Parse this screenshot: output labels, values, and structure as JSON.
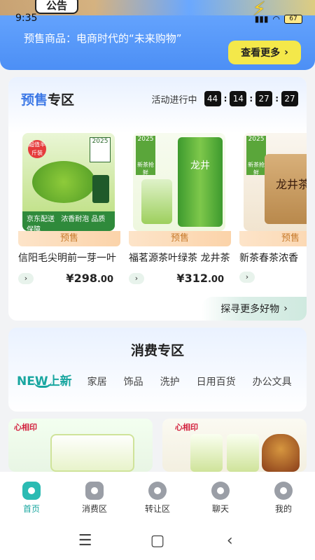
{
  "status_bar": {
    "time": "9:35",
    "battery": "67"
  },
  "notice": {
    "tag": "公告",
    "text": "预售商品：电商时代的“未来购物”",
    "more_button": "查看更多"
  },
  "presale": {
    "title_highlight": "预售",
    "title_rest": "专区",
    "countdown_label": "活动进行中",
    "countdown": [
      "44",
      "14",
      "27",
      "27"
    ],
    "pre_label": "预售",
    "products": [
      {
        "name": "信阳毛尖明前一芽一叶",
        "price_int": "298",
        "price_dec": ".00",
        "img_year": "2025",
        "img_badge": "超值半斤装",
        "tag_line1": "京东配送",
        "tag_line2": "浓香耐泡 品质保障"
      },
      {
        "name": "福茗源茶叶绿茶 龙井茶",
        "price_int": "312",
        "price_dec": ".00",
        "img_year": "2025",
        "img_badge": "新茶抢鲜",
        "can_text": "龙井"
      },
      {
        "name": "新茶春茶浓香",
        "price_int": "",
        "price_dec": "",
        "img_year": "2025",
        "img_badge": "新茶抢鲜",
        "can_text": "龙井茶"
      }
    ],
    "explore_text": "探寻更多好物"
  },
  "consume": {
    "title": "消费专区",
    "tabs": [
      {
        "label": "NEW上新",
        "active": true
      },
      {
        "label": "家居",
        "active": false
      },
      {
        "label": "饰品",
        "active": false
      },
      {
        "label": "洗护",
        "active": false
      },
      {
        "label": "日用百货",
        "active": false
      },
      {
        "label": "办公文具",
        "active": false
      }
    ],
    "cards": [
      {
        "brand": "心相印"
      },
      {
        "brand": "心相印"
      }
    ]
  },
  "bottom_nav": [
    {
      "label": "首页",
      "icon": "home-icon",
      "active": true
    },
    {
      "label": "消费区",
      "icon": "bag-icon",
      "active": false
    },
    {
      "label": "转让区",
      "icon": "transfer-icon",
      "active": false
    },
    {
      "label": "聊天",
      "icon": "chat-icon",
      "active": false
    },
    {
      "label": "我的",
      "icon": "profile-icon",
      "active": false
    }
  ],
  "system_nav": {
    "menu": "☰",
    "home": "▢",
    "back": "‹"
  },
  "colors": {
    "accent": "#19a6a0",
    "banner": "#4c8ff5",
    "presale_blue": "#3c78e6",
    "more_button": "#f4e84a"
  }
}
